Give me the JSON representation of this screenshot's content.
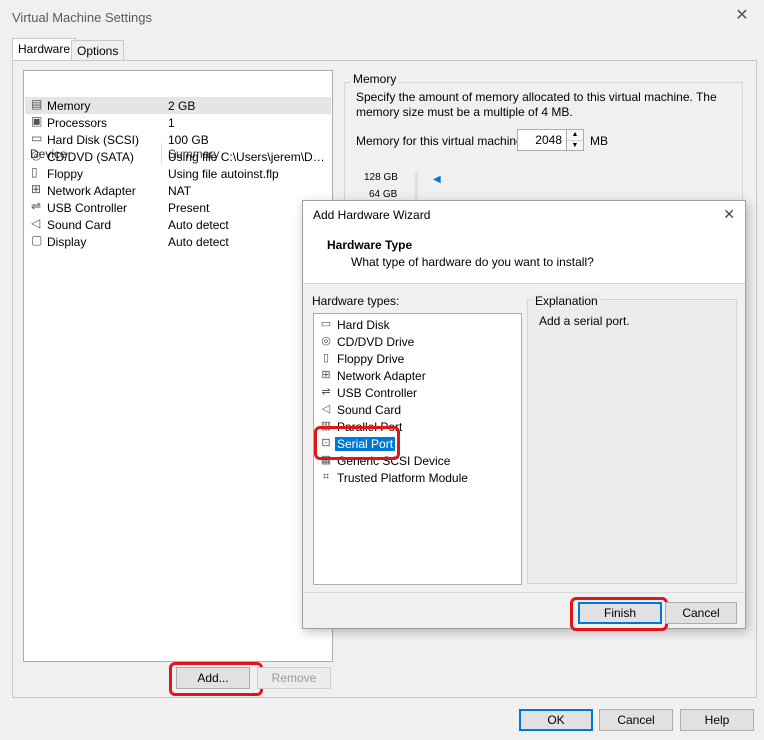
{
  "window": {
    "title": "Virtual Machine Settings"
  },
  "tabs": [
    {
      "label": "Hardware"
    },
    {
      "label": "Options"
    }
  ],
  "device_list": {
    "headers": {
      "device": "Device",
      "summary": "Summary"
    },
    "rows": [
      {
        "icon": "memory-icon",
        "name": "Memory",
        "summary": "2 GB"
      },
      {
        "icon": "processor-icon",
        "name": "Processors",
        "summary": "1"
      },
      {
        "icon": "hard-disk-icon",
        "name": "Hard Disk (SCSI)",
        "summary": "100 GB"
      },
      {
        "icon": "cd-dvd-icon",
        "name": "CD/DVD (SATA)",
        "summary": "Using file C:\\Users\\jerem\\Dow..."
      },
      {
        "icon": "floppy-icon",
        "name": "Floppy",
        "summary": "Using file autoinst.flp"
      },
      {
        "icon": "network-adapter-icon",
        "name": "Network Adapter",
        "summary": "NAT"
      },
      {
        "icon": "usb-icon",
        "name": "USB Controller",
        "summary": "Present"
      },
      {
        "icon": "sound-card-icon",
        "name": "Sound Card",
        "summary": "Auto detect"
      },
      {
        "icon": "display-icon",
        "name": "Display",
        "summary": "Auto detect"
      }
    ]
  },
  "device_buttons": {
    "add": "Add...",
    "remove": "Remove"
  },
  "memory": {
    "group_label": "Memory",
    "description": "Specify the amount of memory allocated to this virtual machine. The memory size must be a multiple of 4 MB.",
    "field_label": "Memory for this virtual machine:",
    "value": "2048",
    "unit": "MB",
    "scale": [
      "128 GB",
      "64 GB"
    ]
  },
  "footer": {
    "ok": "OK",
    "cancel": "Cancel",
    "help": "Help"
  },
  "wizard": {
    "title": "Add Hardware Wizard",
    "heading": "Hardware Type",
    "subheading": "What type of hardware do you want to install?",
    "types_label": "Hardware types:",
    "types": [
      {
        "icon": "hard-disk-icon",
        "name": "Hard Disk"
      },
      {
        "icon": "cd-dvd-icon",
        "name": "CD/DVD Drive"
      },
      {
        "icon": "floppy-icon",
        "name": "Floppy Drive"
      },
      {
        "icon": "network-adapter-icon",
        "name": "Network Adapter"
      },
      {
        "icon": "usb-icon",
        "name": "USB Controller"
      },
      {
        "icon": "sound-card-icon",
        "name": "Sound Card"
      },
      {
        "icon": "parallel-port-icon",
        "name": "Parallel Port"
      },
      {
        "icon": "serial-port-icon",
        "name": "Serial Port"
      },
      {
        "icon": "scsi-device-icon",
        "name": "Generic SCSI Device"
      },
      {
        "icon": "tpm-icon",
        "name": "Trusted Platform Module"
      }
    ],
    "explanation_label": "Explanation",
    "explanation_text": "Add a serial port.",
    "finish": "Finish",
    "cancel": "Cancel"
  }
}
